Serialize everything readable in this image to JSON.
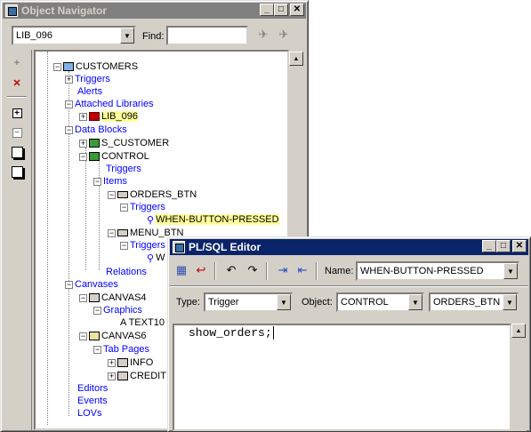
{
  "navigator": {
    "title": "Object Navigator",
    "library_value": "LIB_096",
    "find_label": "Find:",
    "find_value": "",
    "tree": [
      {
        "id": "customers",
        "label": "CUSTOMERS"
      },
      {
        "id": "triggers",
        "label": "Triggers"
      },
      {
        "id": "alerts",
        "label": "Alerts"
      },
      {
        "id": "attached_libraries",
        "label": "Attached Libraries"
      },
      {
        "id": "lib096",
        "label": "LIB_096"
      },
      {
        "id": "data_blocks",
        "label": "Data Blocks"
      },
      {
        "id": "s_customer",
        "label": "S_CUSTOMER"
      },
      {
        "id": "control",
        "label": "CONTROL"
      },
      {
        "id": "control_triggers",
        "label": "Triggers"
      },
      {
        "id": "items",
        "label": "Items"
      },
      {
        "id": "orders_btn",
        "label": "ORDERS_BTN"
      },
      {
        "id": "orders_triggers",
        "label": "Triggers"
      },
      {
        "id": "when_button_pressed",
        "label": "WHEN-BUTTON-PRESSED"
      },
      {
        "id": "menu_btn",
        "label": "MENU_BTN"
      },
      {
        "id": "menu_triggers",
        "label": "Triggers"
      },
      {
        "id": "menu_w",
        "label": "W"
      },
      {
        "id": "relations",
        "label": "Relations"
      },
      {
        "id": "canvases",
        "label": "Canvases"
      },
      {
        "id": "canvas4",
        "label": "CANVAS4"
      },
      {
        "id": "graphics",
        "label": "Graphics"
      },
      {
        "id": "text10",
        "label": "A TEXT10"
      },
      {
        "id": "canvas6",
        "label": "CANVAS6"
      },
      {
        "id": "tab_pages",
        "label": "Tab Pages"
      },
      {
        "id": "info",
        "label": "INFO"
      },
      {
        "id": "credit",
        "label": "CREDIT"
      },
      {
        "id": "editors",
        "label": "Editors"
      },
      {
        "id": "events",
        "label": "Events"
      },
      {
        "id": "lovs",
        "label": "LOVs"
      }
    ]
  },
  "editor": {
    "title": "PL/SQL Editor",
    "name_label": "Name:",
    "name_value": "WHEN-BUTTON-PRESSED",
    "type_label": "Type:",
    "type_value": "Trigger",
    "object_label": "Object:",
    "object_value": "CONTROL",
    "item_value": "ORDERS_BTN",
    "code": "show_orders;"
  },
  "colors": {
    "active_title": "#0a246a",
    "inactive_title": "#808080",
    "highlight": "#ffff99",
    "link": "#0000ff"
  }
}
